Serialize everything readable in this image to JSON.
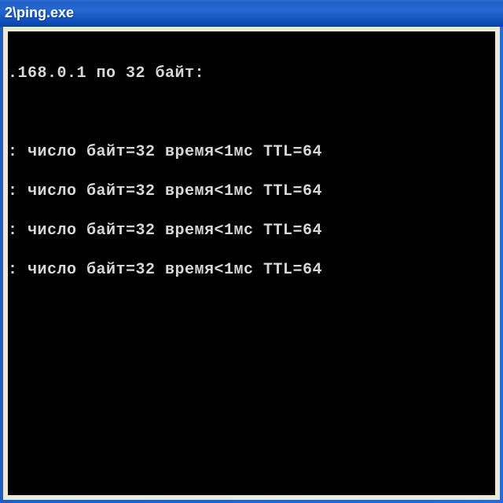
{
  "titlebar": {
    "title": "2\\ping.exe"
  },
  "console": {
    "header": ".168.0.1 по 32 байт:",
    "replies": [
      ": число байт=32 время<1мс TTL=64",
      ": число байт=32 время<1мс TTL=64",
      ": число байт=32 время<1мс TTL=64",
      ": число байт=32 время<1мс TTL=64"
    ]
  }
}
